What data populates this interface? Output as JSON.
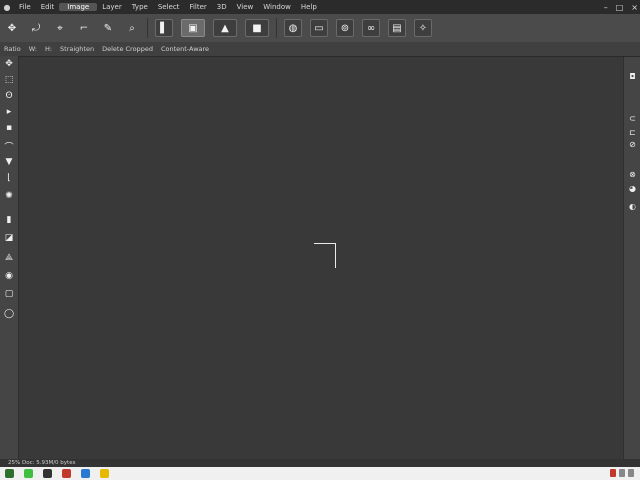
{
  "menubar": {
    "logo_icon": "app-logo-icon",
    "items": [
      "File",
      "Edit",
      "Image",
      "Layer",
      "Type",
      "Select",
      "Filter",
      "3D",
      "View",
      "Window",
      "Help"
    ],
    "window_controls": [
      "–",
      "□",
      "×"
    ]
  },
  "options_bar": {
    "tools": [
      {
        "name": "move-tool-icon",
        "glyph": "✥"
      },
      {
        "name": "rotate-icon",
        "glyph": "⤾"
      },
      {
        "name": "transform-icon",
        "glyph": "⌖"
      },
      {
        "name": "warp-icon",
        "glyph": "⌐"
      },
      {
        "name": "puppet-icon",
        "glyph": "✎"
      },
      {
        "name": "zoom-icon",
        "glyph": "⌕"
      },
      {
        "name": "align-icon",
        "glyph": "▌"
      },
      {
        "name": "frame-icon",
        "glyph": "▣"
      },
      {
        "name": "mountain-icon",
        "glyph": "▲"
      },
      {
        "name": "rect-dark-icon",
        "glyph": "■"
      },
      {
        "name": "globe-icon",
        "glyph": "◍"
      },
      {
        "name": "panel-icon",
        "glyph": "▭"
      },
      {
        "name": "lock-icon",
        "glyph": "⊚"
      },
      {
        "name": "link-icon",
        "glyph": "∞"
      },
      {
        "name": "screen-icon",
        "glyph": "▤"
      },
      {
        "name": "magic-icon",
        "glyph": "✧"
      }
    ]
  },
  "info_bar": {
    "items": [
      "Ratio",
      "W:",
      "H:",
      "Straighten",
      "Delete Cropped",
      "Content-Aware"
    ]
  },
  "toolbox": {
    "tools": [
      {
        "name": "move-icon",
        "glyph": "✥"
      },
      {
        "name": "marquee-icon",
        "glyph": "⬚"
      },
      {
        "name": "lasso-icon",
        "glyph": "ʘ"
      },
      {
        "name": "quick-select-icon",
        "glyph": "▸"
      },
      {
        "name": "crop-icon",
        "glyph": "▪"
      },
      {
        "name": "eyedropper-icon",
        "glyph": "⌒"
      },
      {
        "name": "healing-icon",
        "glyph": "▼"
      },
      {
        "name": "brush-icon",
        "glyph": "⌊"
      },
      {
        "name": "stamp-icon",
        "glyph": "✺"
      },
      {
        "name": "history-icon",
        "glyph": "▮"
      },
      {
        "name": "eraser-icon",
        "glyph": "◪"
      },
      {
        "name": "gradient-icon",
        "glyph": "⟁"
      },
      {
        "name": "dodge-icon",
        "glyph": "◉"
      },
      {
        "name": "pen-icon",
        "glyph": "▢"
      },
      {
        "name": "shape-icon",
        "glyph": "◯"
      }
    ]
  },
  "right_dock": {
    "buttons": [
      {
        "name": "color-panel-icon",
        "glyph": "◘"
      },
      {
        "name": "swatches-icon",
        "glyph": "⊂"
      },
      {
        "name": "adjustments-icon",
        "glyph": "⊏"
      },
      {
        "name": "layers-icon",
        "glyph": "⊘"
      },
      {
        "name": "channels-icon",
        "glyph": "⊗"
      },
      {
        "name": "paths-icon",
        "glyph": "◕"
      },
      {
        "name": "history-panel-icon",
        "glyph": "◐"
      }
    ]
  },
  "status_bar": {
    "text": "25%  Doc: 5.93M/0 bytes"
  },
  "taskbar": {
    "icon_colors": [
      "#2d6f2d",
      "#3fbf3f",
      "#333333",
      "#c0392b",
      "#2a7ad2",
      "#e6b800"
    ]
  }
}
